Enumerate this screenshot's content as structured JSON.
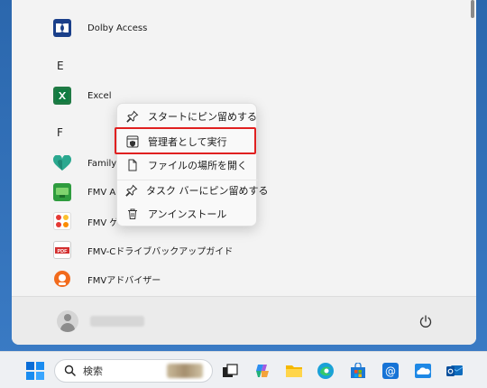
{
  "start_menu": {
    "section_letters": [
      "E",
      "F"
    ],
    "apps": [
      {
        "name": "Dolby Access",
        "icon": "dolby-icon"
      },
      {
        "name": "Excel",
        "icon": "excel-icon"
      },
      {
        "name": "Family",
        "icon": "family-icon"
      },
      {
        "name": "FMV A",
        "icon": "fmv-green-icon"
      },
      {
        "name": "FMV ゲ",
        "icon": "fmv-game-icon"
      },
      {
        "name": "FMV-Cドライブバックアップガイド",
        "icon": "pdf-icon"
      },
      {
        "name": "FMVアドバイザー",
        "icon": "advisor-icon"
      }
    ],
    "power_icon": "power-icon",
    "user_icon": "avatar-icon"
  },
  "context_menu": {
    "items": [
      {
        "label": "スタートにピン留めする",
        "icon": "pin-icon"
      },
      {
        "label": "管理者として実行",
        "icon": "shield-icon",
        "highlighted": true
      },
      {
        "label": "ファイルの場所を開く",
        "icon": "file-icon"
      },
      {
        "label": "タスク バーにピン留めする",
        "icon": "pin-icon"
      },
      {
        "label": "アンインストール",
        "icon": "trash-icon"
      }
    ],
    "highlight_color": "#e02020"
  },
  "taskbar": {
    "search_placeholder": "検索",
    "icons": [
      "start-icon",
      "search-icon",
      "task-view-icon",
      "copilot-icon",
      "file-explorer-icon",
      "edge-icon",
      "store-icon",
      "mail-icon",
      "onedrive-icon",
      "outlook-icon"
    ]
  },
  "colors": {
    "desktop": "#2f6db3",
    "panel": "#f3f3f3",
    "excel_green": "#1f7a44",
    "dolby_blue": "#1a3f8a"
  }
}
